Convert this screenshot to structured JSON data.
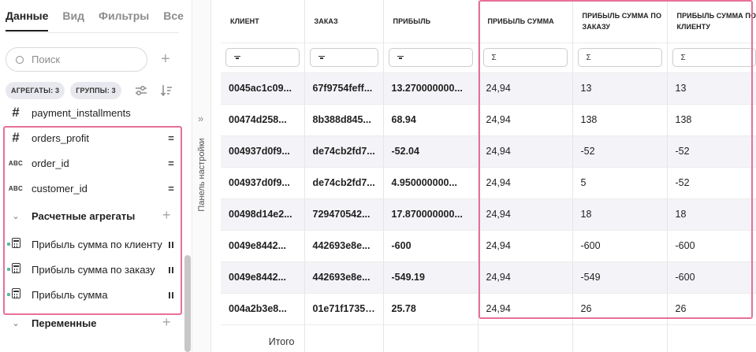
{
  "sidebar": {
    "tabs": [
      {
        "label": "Данные",
        "active": true
      },
      {
        "label": "Вид"
      },
      {
        "label": "Фильтры"
      },
      {
        "label": "Все"
      }
    ],
    "search_placeholder": "Поиск",
    "chips": {
      "aggregates": "АГРЕГАТЫ: 3",
      "groups": "ГРУППЫ: 3"
    },
    "fields": [
      {
        "name": "payment_installments",
        "icon": "hash-icon"
      },
      {
        "name": "orders_profit",
        "icon": "hash-icon",
        "mark": "="
      },
      {
        "name": "order_id",
        "icon": "abc-icon",
        "icon_text": "ABC",
        "mark": "="
      },
      {
        "name": "customer_id",
        "icon": "abc-icon",
        "icon_text": "ABC",
        "mark": "="
      }
    ],
    "group_calc": "Расчетные агрегаты",
    "calc_fields": [
      {
        "name": "Прибыль сумма по клиенту"
      },
      {
        "name": "Прибыль сумма по заказу"
      },
      {
        "name": "Прибыль сумма"
      }
    ],
    "group_vars": "Переменные",
    "accent_dot_color": "#5cb8a5"
  },
  "strip": {
    "label": "Панель настройки"
  },
  "table": {
    "columns": [
      "КЛИЕНТ",
      "ЗАКАЗ",
      "ПРИБЫЛЬ",
      "ПРИБЫЛЬ СУММА",
      "ПРИБЫЛЬ СУММА ПО ЗАКАЗУ",
      "ПРИБЫЛЬ СУММА ПО КЛИЕНТУ"
    ],
    "filter_icons": [
      "filter-icon",
      "filter-icon",
      "filter-icon",
      "sigma-icon",
      "sigma-icon",
      "sigma-icon"
    ],
    "sigma": "Σ",
    "rows": [
      [
        "0045ac1c09...",
        "67f9754feff...",
        "13.270000000...",
        "24,94",
        "13",
        "13"
      ],
      [
        "00474d258...",
        "8b388d845...",
        "68.94",
        "24,94",
        "138",
        "138"
      ],
      [
        "004937d0f9...",
        "de74cb2fd7...",
        "-52.04",
        "24,94",
        "-52",
        "-52"
      ],
      [
        "004937d0f9...",
        "de74cb2fd7...",
        "4.950000000...",
        "24,94",
        "5",
        "-52"
      ],
      [
        "00498d14e2...",
        "729470542...",
        "17.870000000...",
        "24,94",
        "18",
        "18"
      ],
      [
        "0049e8442...",
        "442693e8e...",
        "-600",
        "24,94",
        "-600",
        "-600"
      ],
      [
        "0049e8442...",
        "442693e8e...",
        "-549.19",
        "24,94",
        "-549",
        "-600"
      ],
      [
        "004a2b3e8...",
        "01e71f17355...",
        "25.78",
        "24,94",
        "26",
        "26"
      ]
    ],
    "total_label": "Итого"
  },
  "highlight_color": "#e8709a"
}
